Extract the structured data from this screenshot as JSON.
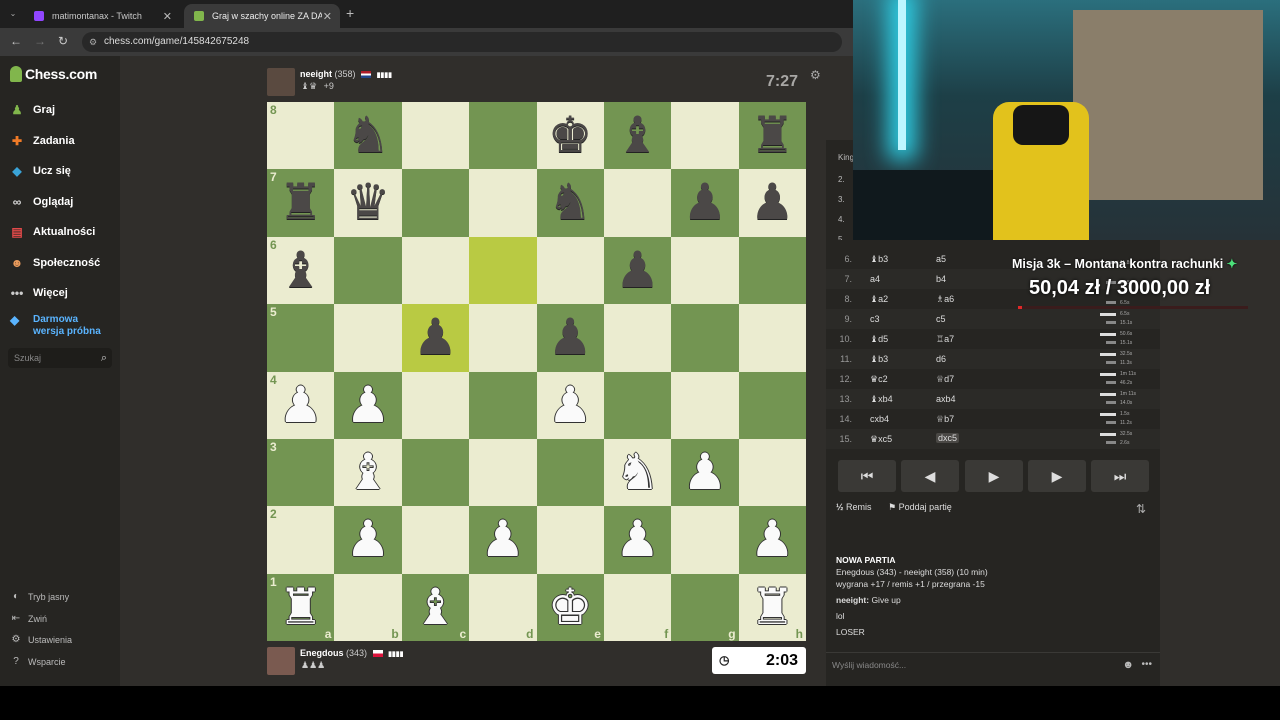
{
  "browser": {
    "tabs": [
      {
        "title": "matimontanax - Twitch",
        "favicon_color": "#9146ff"
      },
      {
        "title": "Graj w szachy online ZA DARMO",
        "favicon_color": "#81b64c"
      }
    ],
    "url": "chess.com/game/145842675248"
  },
  "sidebar": {
    "logo": "Chess.com",
    "items": [
      {
        "label": "Graj",
        "icon": "play-icon"
      },
      {
        "label": "Zadania",
        "icon": "puzzle-icon"
      },
      {
        "label": "Ucz się",
        "icon": "learn-icon"
      },
      {
        "label": "Oglądaj",
        "icon": "watch-icon"
      },
      {
        "label": "Aktualności",
        "icon": "news-icon"
      },
      {
        "label": "Społeczność",
        "icon": "community-icon"
      },
      {
        "label": "Więcej",
        "icon": "more-icon"
      }
    ],
    "trial": "Darmowa wersja próbna",
    "search_placeholder": "Szukaj",
    "bottom": [
      {
        "label": "Tryb jasny",
        "icon": "theme-icon"
      },
      {
        "label": "Zwiń",
        "icon": "collapse-icon"
      },
      {
        "label": "Ustawienia",
        "icon": "settings-icon"
      },
      {
        "label": "Wsparcie",
        "icon": "help-icon"
      }
    ]
  },
  "top_player": {
    "name": "neeight",
    "rating": "(358)",
    "captured": "♝♛",
    "advantage": "+9",
    "clock": "7:27"
  },
  "bottom_player": {
    "name": "Enegdous",
    "rating": "(343)",
    "captured": "♟♟♟",
    "clock": "2:03"
  },
  "board": {
    "files": [
      "a",
      "b",
      "c",
      "d",
      "e",
      "f",
      "g",
      "h"
    ],
    "ranks": [
      "8",
      "7",
      "6",
      "5",
      "4",
      "3",
      "2",
      "1"
    ],
    "highlight_squares": [
      "d6",
      "c5"
    ],
    "pieces": [
      [
        "",
        "bn",
        "",
        "",
        "bk",
        "bb",
        "",
        "br"
      ],
      [
        "br",
        "bq",
        "",
        "",
        "bn",
        "",
        "bp",
        "bp"
      ],
      [
        "bb",
        "",
        "",
        "",
        "",
        "bp",
        "",
        ""
      ],
      [
        "",
        "",
        "bp",
        "",
        "bp",
        "",
        "",
        ""
      ],
      [
        "wp",
        "wp",
        "",
        "",
        "wp",
        "",
        "",
        ""
      ],
      [
        "",
        "wb",
        "",
        "",
        "",
        "wn",
        "wp",
        ""
      ],
      [
        "",
        "wp",
        "",
        "wp",
        "",
        "wp",
        "",
        "wp"
      ],
      [
        "wr",
        "",
        "wb",
        "",
        "wk",
        "",
        "",
        "wr"
      ]
    ]
  },
  "moves_panel": {
    "side_labels": [
      "King",
      "2.",
      "3.",
      "4.",
      "5."
    ],
    "moves": [
      {
        "n": "6.",
        "w": "♝b3",
        "b": "a5",
        "wt": "",
        "bt": "11.8s"
      },
      {
        "n": "7.",
        "w": "a4",
        "b": "b4",
        "wt": "",
        "bt": "25.5s"
      },
      {
        "n": "8.",
        "w": "♝a2",
        "b": "♗a6",
        "wt": "",
        "bt": "6.5s"
      },
      {
        "n": "9.",
        "w": "c3",
        "b": "c5",
        "wt": "6.5s",
        "bt": "15.1s"
      },
      {
        "n": "10.",
        "w": "♝d5",
        "b": "♖a7",
        "wt": "50.6s",
        "bt": "15.1s"
      },
      {
        "n": "11.",
        "w": "♝b3",
        "b": "d6",
        "wt": "32.5s",
        "bt": "11.3s"
      },
      {
        "n": "12.",
        "w": "♛c2",
        "b": "♕d7",
        "wt": "1m 11s",
        "bt": "46.2s"
      },
      {
        "n": "13.",
        "w": "♝xb4",
        "b": "axb4",
        "wt": "1m 11s",
        "bt": "14.0s"
      },
      {
        "n": "14.",
        "w": "cxb4",
        "b": "♕b7",
        "wt": "1.5s",
        "bt": "11.2s"
      },
      {
        "n": "15.",
        "w": "♛xc5",
        "b": "dxc5",
        "wt": "32.5s",
        "bt": "2.6s"
      }
    ],
    "controls": [
      "⏮",
      "◀",
      "▶",
      "▶",
      "⏭"
    ],
    "draw": "Remis",
    "draw_prefix": "½",
    "resign": "Poddaj partię"
  },
  "chat": {
    "heading": "NOWA PARTIA",
    "line1": "Enegdous (343) - neeight (358) (10 min)",
    "line2": "wygrana +17 / remis +1 / przegrana -15",
    "msg_user": "neeight:",
    "msg_text": "Give up",
    "line_lol": "lol",
    "line_loser": "LOSER",
    "input_placeholder": "Wyślij wiadomość..."
  },
  "overlay": {
    "title": "Misja 3k – Montana kontra rachunki",
    "amount": "50,04 zł / 3000,00 zł",
    "progress_fraction": 0.0167
  }
}
